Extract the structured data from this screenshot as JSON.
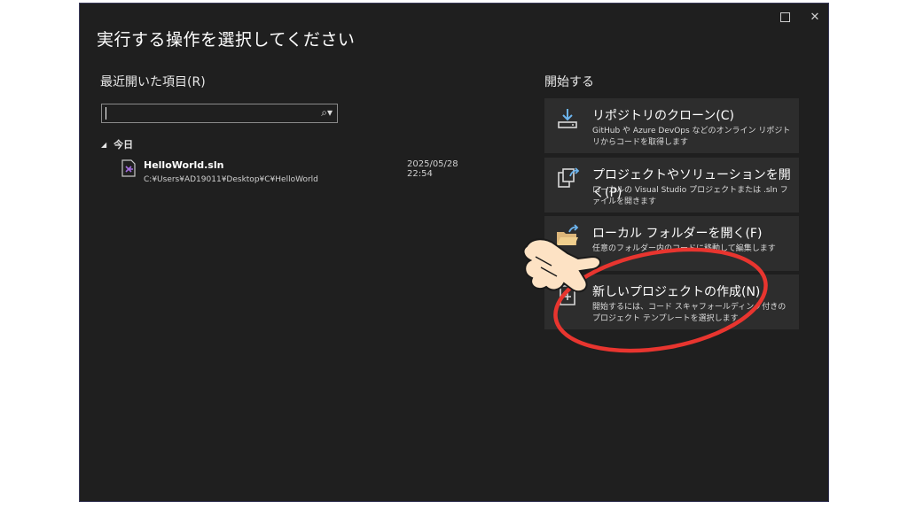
{
  "window": {
    "title": "実行する操作を選択してください",
    "close_glyph": "✕"
  },
  "recent": {
    "heading": "最近開いた項目(R)",
    "search": {
      "value": "",
      "icon_glyph": "⌕▾"
    },
    "group_label": "今日",
    "group_glyph": "◢",
    "items": [
      {
        "name": "HelloWorld.sln",
        "path": "C:¥Users¥AD19011¥Desktop¥C¥HelloWorld",
        "date": "2025/05/28 22:54"
      }
    ]
  },
  "start": {
    "heading": "開始する",
    "cards": [
      {
        "title": "リポジトリのクローン(C)",
        "desc": "GitHub や Azure DevOps などのオンライン リポジトリからコードを取得します",
        "icon": "download-icon"
      },
      {
        "title": "プロジェクトやソリューションを開く(P)",
        "desc": "ローカルの Visual Studio プロジェクトまたは .sln ファイルを開きます",
        "icon": "open-project-icon"
      },
      {
        "title": "ローカル フォルダーを開く(F)",
        "desc": "任意のフォルダー内のコードに移動して編集します",
        "icon": "open-folder-icon"
      },
      {
        "title": "新しいプロジェクトの作成(N)",
        "desc": "開始するには、コード スキャフォールディング付きのプロジェクト テンプレートを選択します",
        "icon": "new-project-icon"
      }
    ]
  },
  "colors": {
    "window_bg": "#1f1f1f",
    "card_bg": "#2d2d2d",
    "annotation_red": "#e8352f",
    "hand_fill": "#fde2c4"
  }
}
